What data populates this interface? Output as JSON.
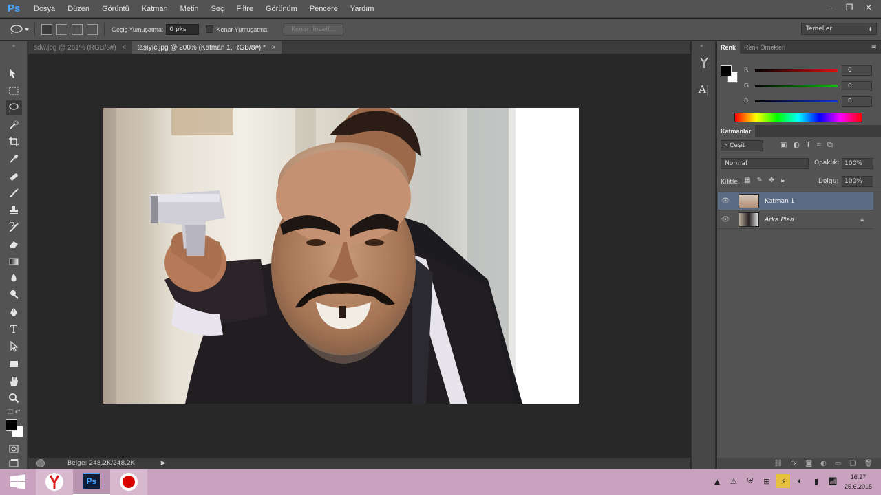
{
  "app": {
    "logo": "Ps",
    "menu": [
      "Dosya",
      "Düzen",
      "Görüntü",
      "Katman",
      "Metin",
      "Seç",
      "Filtre",
      "Görünüm",
      "Pencere",
      "Yardım"
    ],
    "window_controls": {
      "minimize": "–",
      "restore": "❐",
      "close": "✕"
    }
  },
  "options": {
    "feather_label": "Geçiş Yumuşatma:",
    "feather_value": "0 pks",
    "antialias_label": "Kenar Yumuşatma",
    "refine_edge_label": "Kenarı İncelt...",
    "workspace": "Temeller"
  },
  "tabs": [
    {
      "label": "sdw.jpg @ 261% (RGB/8#)",
      "close": "×",
      "active": false
    },
    {
      "label": "taşıyıc.jpg @ 200% (Katman 1, RGB/8#) *",
      "close": "×",
      "active": true
    }
  ],
  "status": {
    "doc_info": "Belge: 248,2K/248,2K",
    "arrow": "▶"
  },
  "color_panel": {
    "tabs": [
      "Renk",
      "Renk Örnekleri"
    ],
    "channels": [
      {
        "label": "R",
        "value": "0",
        "color": "#d01010"
      },
      {
        "label": "G",
        "value": "0",
        "color": "#10b010"
      },
      {
        "label": "B",
        "value": "0",
        "color": "#1020d0"
      }
    ]
  },
  "layers_panel": {
    "title": "Katmanlar",
    "filter": "Çeşit",
    "blend_mode": "Normal",
    "opacity_label": "Opaklık:",
    "opacity_value": "100%",
    "lock_label": "Kilitle:",
    "fill_label": "Dolgu:",
    "fill_value": "100%",
    "layers": [
      {
        "name": "Katman 1",
        "selected": true,
        "locked": false
      },
      {
        "name": "Arka Plan",
        "selected": false,
        "locked": true
      }
    ]
  },
  "taskbar": {
    "time": "16:27",
    "date": "25.6.2015",
    "apps": [
      "yandex-browser",
      "photoshop",
      "screen-recorder"
    ]
  },
  "colors": {
    "accent": "#4aa3ff",
    "selected_layer": "#5b6b84",
    "taskbar": "#c9a2bf"
  }
}
